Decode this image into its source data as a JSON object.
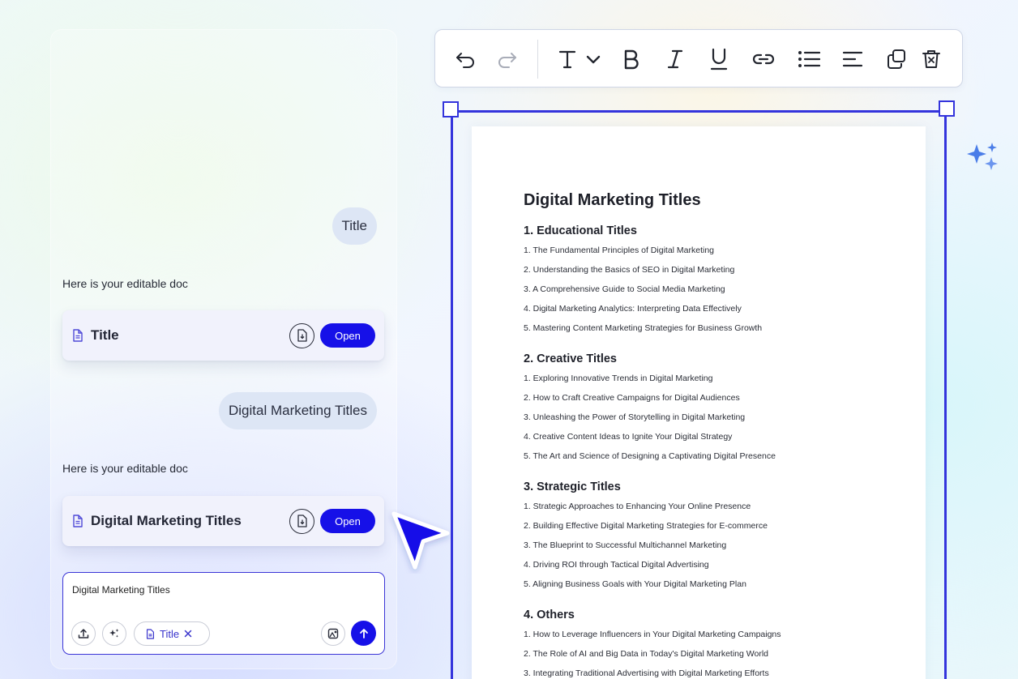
{
  "chat": {
    "messages": [
      {
        "role": "user",
        "text": "Title"
      },
      {
        "role": "assistant",
        "text": "Here is your editable doc",
        "doc_title": "Title",
        "open_label": "Open"
      },
      {
        "role": "user",
        "text": "Digital Marketing Titles"
      },
      {
        "role": "assistant",
        "text": "Here is your editable doc",
        "doc_title": "Digital Marketing Titles",
        "open_label": "Open"
      }
    ],
    "composer": {
      "text": "Digital Marketing Titles",
      "chip_label": "Title"
    }
  },
  "toolbar": {
    "tools": [
      "undo",
      "redo",
      "text-style",
      "bold",
      "italic",
      "underline",
      "link",
      "bulleted-list",
      "align-left",
      "duplicate",
      "delete"
    ],
    "accent": "#1610e8"
  },
  "document": {
    "title": "Digital Marketing Titles",
    "sections": [
      {
        "heading": "1. Educational Titles",
        "items": [
          "1. The Fundamental Principles of Digital Marketing",
          "2. Understanding the Basics of SEO in Digital Marketing",
          "3. A Comprehensive Guide to Social Media Marketing",
          "4. Digital Marketing Analytics: Interpreting Data Effectively",
          "5. Mastering Content Marketing Strategies for Business Growth"
        ]
      },
      {
        "heading": "2. Creative Titles",
        "items": [
          "1. Exploring Innovative Trends in Digital Marketing",
          "2. How to Craft Creative Campaigns for Digital Audiences",
          "3. Unleashing the Power of Storytelling in Digital Marketing",
          "4. Creative Content Ideas to Ignite Your Digital Strategy",
          "5. The Art and Science of Designing a Captivating Digital Presence"
        ]
      },
      {
        "heading": "3. Strategic Titles",
        "items": [
          "1. Strategic Approaches to Enhancing Your Online Presence",
          "2. Building Effective Digital Marketing Strategies for E-commerce",
          "3. The Blueprint to Successful Multichannel Marketing",
          "4. Driving ROI through Tactical Digital Advertising",
          "5. Aligning Business Goals with Your Digital Marketing Plan"
        ]
      },
      {
        "heading": "4. Others",
        "items": [
          "1. How to Leverage Influencers in Your Digital Marketing Campaigns",
          "2. The Role of AI and Big Data in Today's Digital Marketing World",
          "3. Integrating Traditional Advertising with Digital Marketing Efforts"
        ]
      }
    ]
  }
}
